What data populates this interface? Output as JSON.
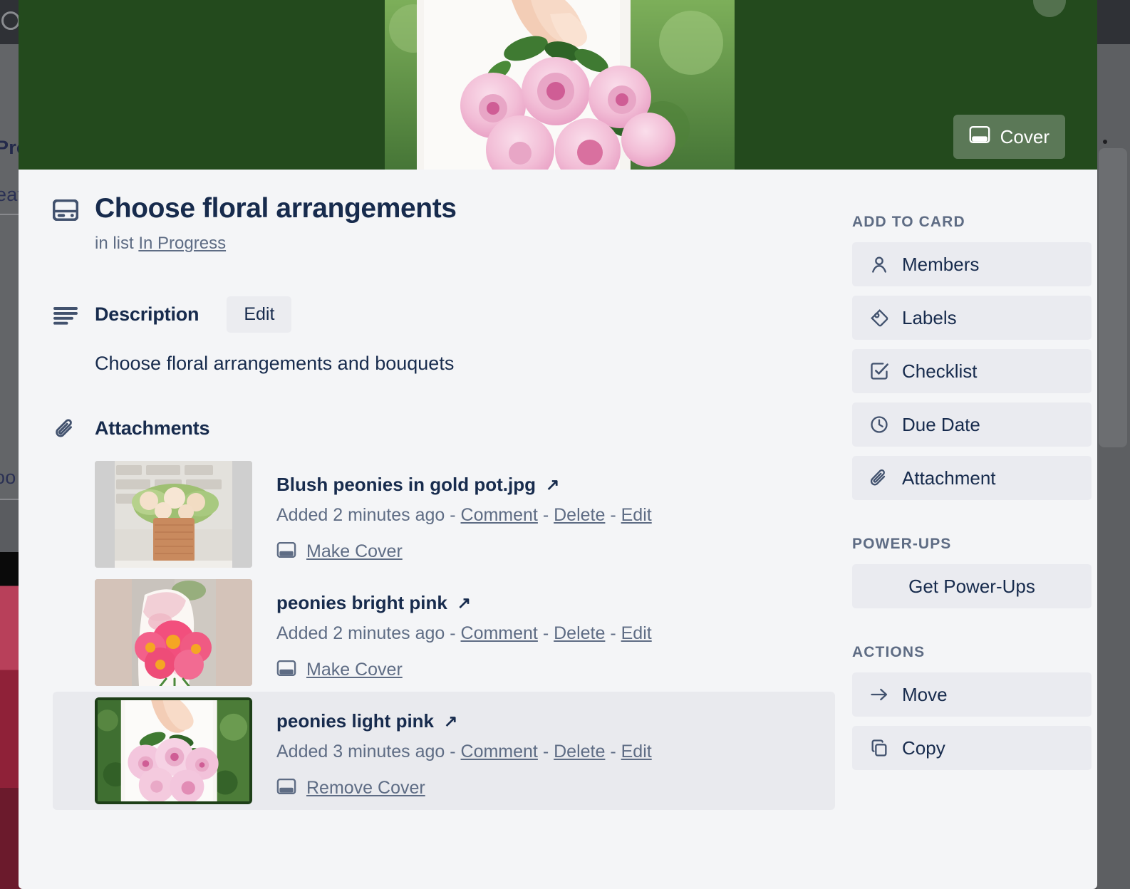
{
  "background_board": {
    "fragment_texts": [
      "Pro",
      "eat",
      "oo"
    ],
    "dimmed": true
  },
  "cover": {
    "button_label": "Cover",
    "button_icon": "cover-icon",
    "background_color": "#234a1d",
    "close_icon": "close-icon"
  },
  "card": {
    "icon": "card-icon",
    "title": "Choose floral arrangements",
    "in_list_prefix": "in list",
    "list_name": "In Progress"
  },
  "description": {
    "icon": "description-icon",
    "heading": "Description",
    "edit_label": "Edit",
    "text": "Choose floral arrangements and bouquets"
  },
  "attachments": {
    "icon": "paperclip-icon",
    "heading": "Attachments",
    "items": [
      {
        "name": "Blush peonies in gold pot.jpg",
        "external_link_icon": "external-link-icon",
        "added": "Added 2 minutes ago",
        "sep": "-",
        "comment": "Comment",
        "delete": "Delete",
        "edit": "Edit",
        "cover_action": "Make Cover",
        "cover_icon": "cover-icon",
        "is_cover": false,
        "thumb_bg": "#cfcfcf"
      },
      {
        "name": "peonies bright pink",
        "external_link_icon": "external-link-icon",
        "added": "Added 2 minutes ago",
        "sep": "-",
        "comment": "Comment",
        "delete": "Delete",
        "edit": "Edit",
        "cover_action": "Make Cover",
        "cover_icon": "cover-icon",
        "is_cover": false,
        "thumb_bg": "#d4c3b9"
      },
      {
        "name": "peonies light pink",
        "external_link_icon": "external-link-icon",
        "added": "Added 3 minutes ago",
        "sep": "-",
        "comment": "Comment",
        "delete": "Delete",
        "edit": "Edit",
        "cover_action": "Remove Cover",
        "cover_icon": "cover-icon",
        "is_cover": true,
        "thumb_bg": "#ffffff"
      }
    ]
  },
  "sidebar": {
    "add_to_card": {
      "heading": "ADD TO CARD",
      "items": [
        {
          "label": "Members",
          "icon": "member-icon"
        },
        {
          "label": "Labels",
          "icon": "label-icon"
        },
        {
          "label": "Checklist",
          "icon": "checklist-icon"
        },
        {
          "label": "Due Date",
          "icon": "clock-icon"
        },
        {
          "label": "Attachment",
          "icon": "paperclip-icon"
        }
      ]
    },
    "power_ups": {
      "heading": "POWER-UPS",
      "items": [
        {
          "label": "Get Power-Ups",
          "icon": "none"
        }
      ]
    },
    "actions": {
      "heading": "ACTIONS",
      "items": [
        {
          "label": "Move",
          "icon": "arrow-right-icon"
        },
        {
          "label": "Copy",
          "icon": "copy-icon"
        }
      ]
    }
  },
  "colors": {
    "modal_bg": "#f4f5f7",
    "cover_green": "#234a1d",
    "text_primary": "#172b4d",
    "text_muted": "#5e6c84",
    "button_bg": "#eaebf0",
    "cover_border": "#1e3f18"
  }
}
